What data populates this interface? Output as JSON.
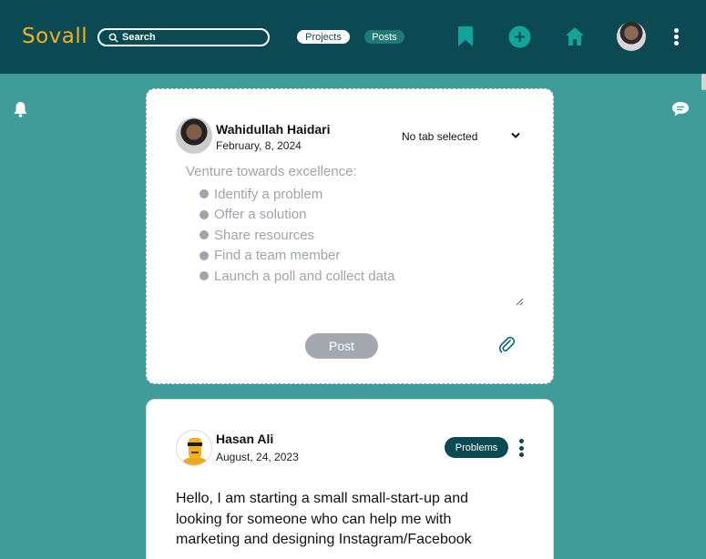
{
  "header": {
    "logo": "Sovall",
    "search_label": "Search",
    "tabs": [
      {
        "label": "Projects",
        "active": true
      },
      {
        "label": "Posts",
        "active": false
      }
    ],
    "icons": [
      "bookmark-icon",
      "plus-circle-icon",
      "home-icon",
      "user-avatar",
      "more-vertical-icon"
    ]
  },
  "sidebar": {
    "left_icon": "bell-icon",
    "right_icon": "chat-icon"
  },
  "composer": {
    "author": "Wahidullah Haidari",
    "date": "February, 8, 2024",
    "tab_select": "No tab selected",
    "placeholder_intro": "Venture towards excellence:",
    "placeholder_items": [
      "Identify a problem",
      "Offer a solution",
      "Share resources",
      "Find a team member",
      "Launch a poll and collect data"
    ],
    "post_button": "Post"
  },
  "feed": {
    "posts": [
      {
        "author": "Hasan Ali",
        "date": "August, 24, 2023",
        "badge": "Problems",
        "text": "Hello, I am starting a small small-start-up and looking for someone who can help me with marketing and designing Instagram/Facebook"
      }
    ]
  },
  "colors": {
    "header_bg": "#0b4a53",
    "page_bg": "#3f9c99",
    "accent_teal": "#12a39a",
    "logo_yellow": "#f2b01e"
  }
}
